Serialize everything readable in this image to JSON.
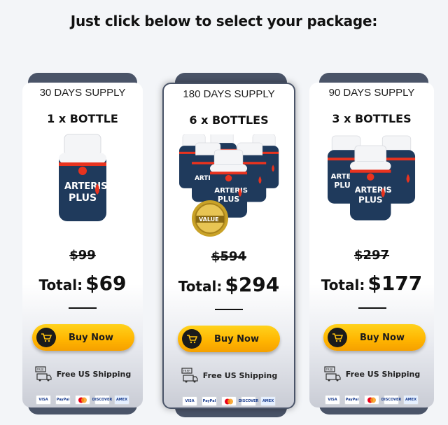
{
  "headline": "Just click below to select your package:",
  "packages": [
    {
      "supply": "30 DAYS SUPPLY",
      "quantity": "1 x BOTTLE",
      "old_price": "$99",
      "total_label": "Total:",
      "total_price": "$69",
      "buy_label": "Buy Now",
      "shipping": "Free US Shipping",
      "bottles": 1
    },
    {
      "supply": "180 DAYS SUPPLY",
      "quantity": "6 x BOTTLES",
      "old_price": "$594",
      "total_label": "Total:",
      "total_price": "$294",
      "buy_label": "Buy Now",
      "shipping": "Free US Shipping",
      "bottles": 6,
      "badge": "VALUE"
    },
    {
      "supply": "90 DAYS SUPPLY",
      "quantity": "3 x BOTTLES",
      "old_price": "$297",
      "total_label": "Total:",
      "total_price": "$177",
      "buy_label": "Buy Now",
      "shipping": "Free US Shipping",
      "bottles": 3
    }
  ],
  "product_label": {
    "line1": "ARTERIS",
    "line2": "PLUS"
  },
  "payment_methods": [
    "VISA",
    "PayPal",
    "mastercard",
    "DISCOVER",
    "AMEX"
  ],
  "colors": {
    "background": "#f3f5f8",
    "tab": "#4a5468",
    "button": "#ffc20e",
    "bottle_label": "#1f3a5c",
    "bottle_accent": "#e8331f"
  }
}
